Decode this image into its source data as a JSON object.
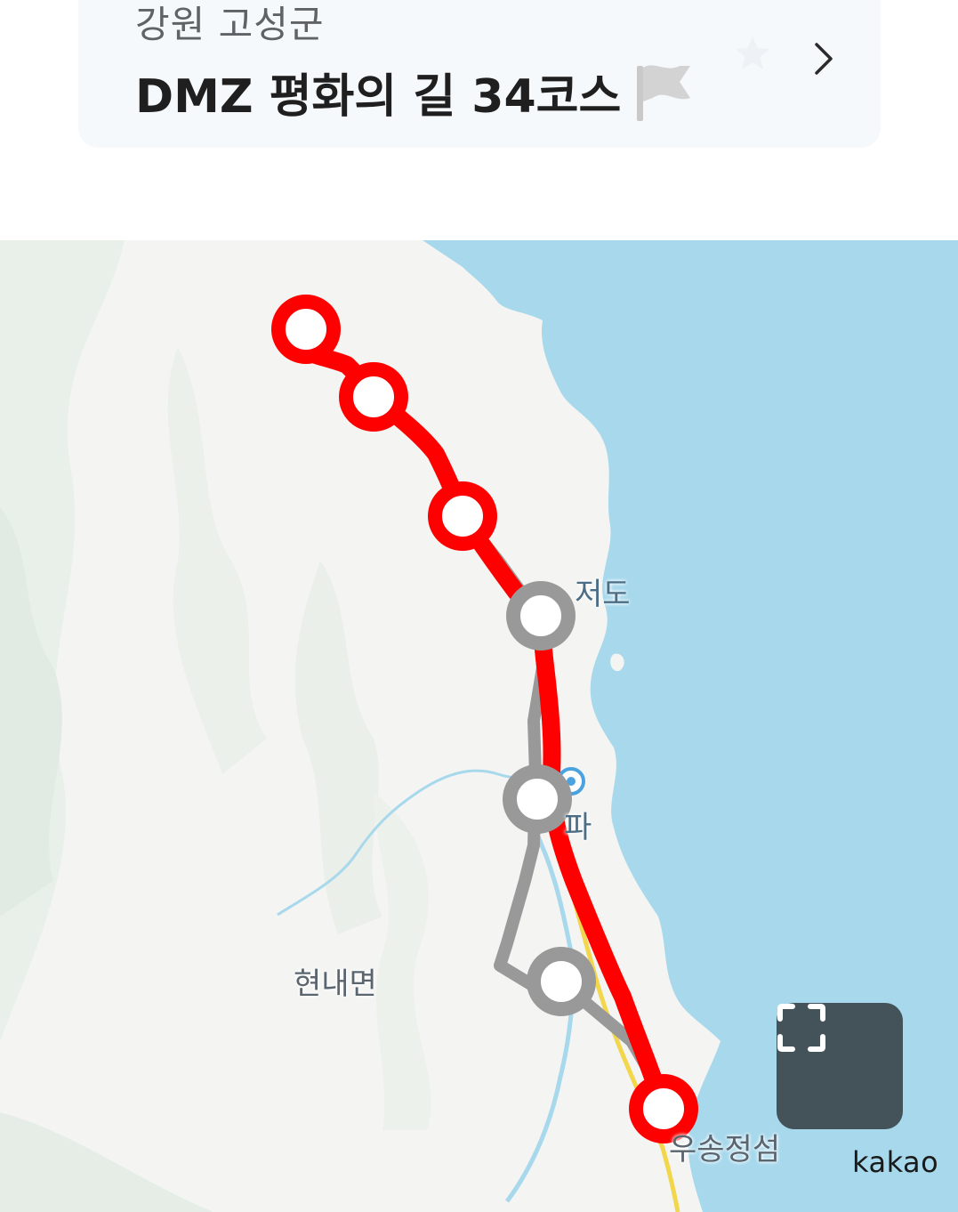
{
  "header": {
    "region": "강원 고성군",
    "title": "DMZ 평화의 길 34코스"
  },
  "icons": {
    "flag": "flag-icon",
    "star": "star-icon",
    "chevron": "chevron-right-icon",
    "fullscreen": "fullscreen-icon",
    "pin": "map-pin-icon"
  },
  "map": {
    "labels": {
      "jeodo": "저도",
      "daejin_suffix": "파",
      "hyeonnae": "현내면",
      "songjeong": "우송정섬"
    },
    "attribution": "kakao"
  },
  "colors": {
    "route": "#ff0000",
    "alt_route": "#999999",
    "sea": "#a7d8ec",
    "land": "#f4f5f3",
    "button": "#44525a"
  }
}
